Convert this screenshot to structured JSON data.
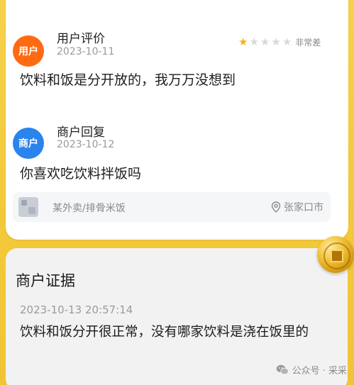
{
  "user_review": {
    "avatar_label": "用户",
    "role": "用户评价",
    "date": "2023-10-11",
    "rating": 1,
    "rating_max": 5,
    "rating_label": "非常差",
    "text": "饮料和饭是分开放的，我万万没想到"
  },
  "merchant_reply": {
    "avatar_label": "商户",
    "role": "商户回复",
    "date": "2023-10-12",
    "text": "你喜欢吃饮料拌饭吗"
  },
  "order": {
    "name": "某外卖/排骨米饭",
    "location": "张家口市"
  },
  "evidence": {
    "title": "商户证据",
    "datetime": "2023-10-13 20:57:14",
    "text": "饮料和饭分开很正常，没有哪家饮料是浇在饭里的"
  },
  "watermark": {
    "text": "公众号 · 采采"
  },
  "colors": {
    "user_avatar": "#ff6a12",
    "merchant_avatar": "#2a84ee",
    "star_on": "#f5b400",
    "background": "#f3c93a"
  }
}
